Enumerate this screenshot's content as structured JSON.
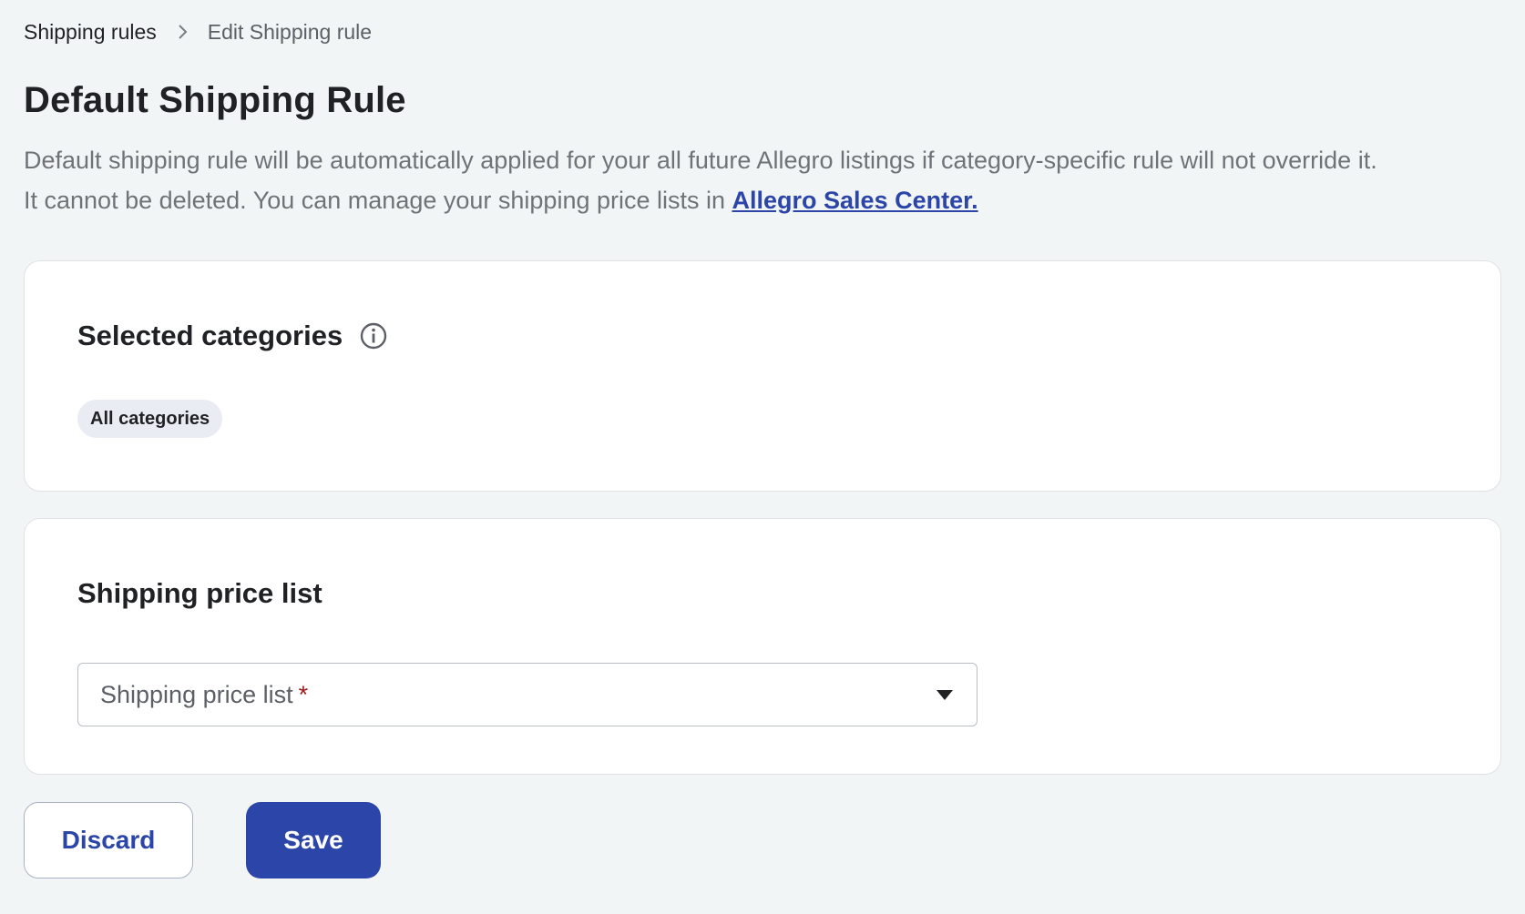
{
  "breadcrumb": {
    "parent": "Shipping rules",
    "current": "Edit Shipping rule"
  },
  "page_title": "Default Shipping Rule",
  "description": {
    "line1": "Default shipping rule will be automatically applied for your all future Allegro listings if category-specific rule will not override it.",
    "line2": "It cannot be deleted. You can manage your shipping price lists in ",
    "link": "Allegro Sales Center."
  },
  "categories_card": {
    "title": "Selected categories",
    "chips": [
      "All categories"
    ]
  },
  "pricelist_card": {
    "title": "Shipping price list",
    "select_placeholder": "Shipping price list",
    "required_mark": "*"
  },
  "actions": {
    "discard_label": "Discard",
    "save_label": "Save"
  },
  "colors": {
    "accent": "#2b45a8",
    "background": "#f2f5f6",
    "required": "#a01a1a"
  },
  "icons": {
    "breadcrumb_separator": "chevron-right-icon",
    "categories_info": "info-icon",
    "select_caret": "caret-down-icon"
  }
}
